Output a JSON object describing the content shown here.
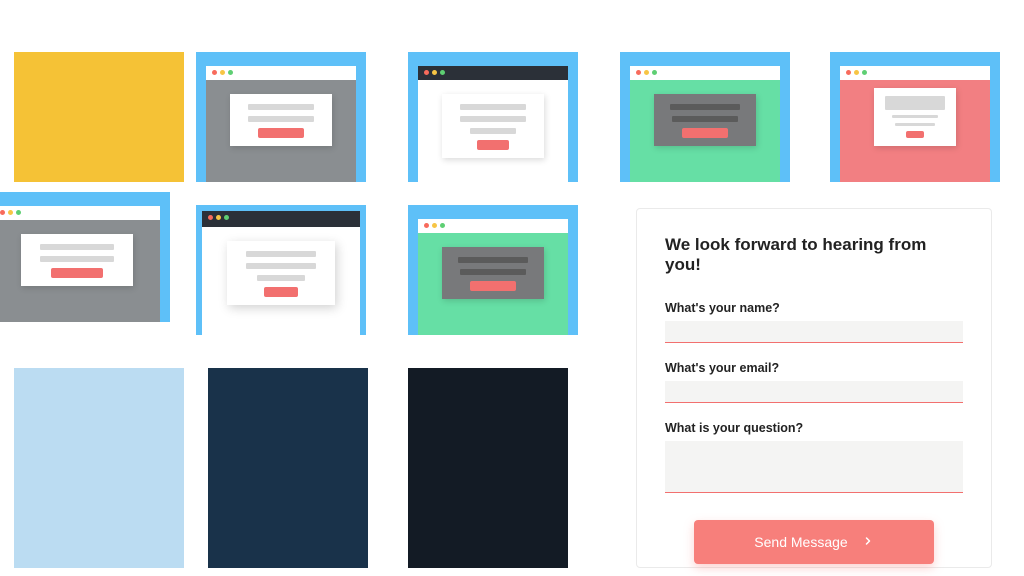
{
  "thumbnails": {
    "row1": [
      {
        "style": "solid-yellow"
      },
      {
        "style": "gray-modal-white"
      },
      {
        "style": "white-modal-white"
      },
      {
        "style": "green-modal-gray"
      },
      {
        "style": "pink-modal-small"
      }
    ],
    "row2": [
      {
        "style": "gray-modal-cut"
      },
      {
        "style": "white-modal-dark-chrome"
      },
      {
        "style": "green-modal-gray"
      }
    ],
    "row3": [
      {
        "style": "solid-lightblue"
      },
      {
        "style": "solid-navy"
      },
      {
        "style": "solid-slate"
      }
    ]
  },
  "form": {
    "title": "We look forward to hearing from you!",
    "name_label": "What's your name?",
    "email_label": "What's your email?",
    "question_label": "What is your question?",
    "send_label": "Send Message",
    "name_value": "",
    "email_value": "",
    "question_value": ""
  },
  "colors": {
    "accent": "#f77f7b",
    "thumb_bg": "#5ec0f8"
  }
}
